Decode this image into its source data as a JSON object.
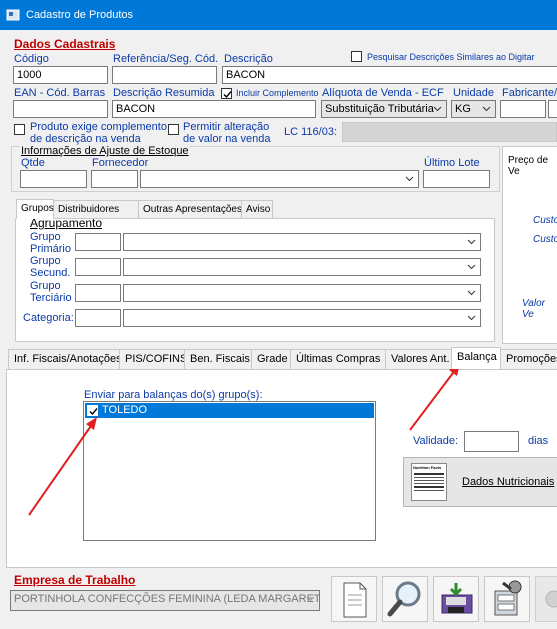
{
  "window": {
    "title": "Cadastro de Produtos"
  },
  "dados": {
    "section_title": "Dados Cadastrais",
    "codigo_label": "Código",
    "codigo_value": "1000",
    "referencia_label": "Referência/Seg. Cód.",
    "referencia_value": "",
    "descricao_label": "Descrição",
    "descricao_value": "BACON",
    "pesquisar_label": "Pesquisar Descrições Similares ao Digitar",
    "ean_label": "EAN - Cód. Barras",
    "ean_value": "",
    "desc_resumida_label": "Descrição Resumida",
    "desc_resumida_value": "BACON",
    "incluir_label": "Incluir Complemento",
    "aliquota_label": "Alíquota de Venda - ECF",
    "aliquota_value": "Substituição Tributária",
    "unidade_label": "Unidade",
    "unidade_value": "KG",
    "fabricante_label": "Fabricante/M",
    "produto_exige_label_1": "Produto exige complemento",
    "produto_exige_label_2": "de descrição na venda",
    "permitir_label_1": "Permitir alteração",
    "permitir_label_2": "de valor na venda",
    "lc_label": "LC 116/03:"
  },
  "estoque": {
    "title": "Informações de Ajuste de Estoque",
    "qtde_label": "Qtde",
    "fornecedor_label": "Fornecedor",
    "ultimo_lote_label": "Último Lote"
  },
  "right_panel": {
    "preco_label": "Preço de Ve",
    "custo1": "Custo",
    "custo2": "Custo",
    "valor_venda": "Valor Ve"
  },
  "upper_tabs": [
    "Grupos",
    "Distribuidores",
    "Outras Apresentações",
    "Aviso"
  ],
  "agrupamento": {
    "title": "Agrupamento",
    "grupo_primario": [
      "Grupo",
      "Primário"
    ],
    "grupo_secund": [
      "Grupo",
      "Secund."
    ],
    "grupo_terciario": [
      "Grupo",
      "Terciário"
    ],
    "categoria": "Categoria:"
  },
  "lower_tabs": [
    "Inf. Fiscais/Anotações",
    "PIS/COFINS",
    "Ben. Fiscais",
    "Grade",
    "Últimas Compras",
    "Valores Ant.",
    "Balança",
    "Promoções"
  ],
  "balanca": {
    "enviar_label": "Enviar para balanças do(s) grupo(s):",
    "items": [
      {
        "label": "TOLEDO",
        "checked": true
      }
    ],
    "validade_label": "Validade:",
    "validade_value": "",
    "dias_label": "dias",
    "nutri_label": "Dados Nutricionais",
    "nutri_icon_text": "Nutrition Facts"
  },
  "empresa": {
    "title": "Empresa de Trabalho",
    "value": "PORTINHOLA CONFECÇÕES FEMININA (LEDA MARGARETE"
  },
  "colors": {
    "titlebar": "#0078d7",
    "selection": "#0078d7",
    "arrow": "#e02020",
    "label_blue": "#0b3aa8",
    "section_red": "#c00000"
  },
  "toolbar_icons": [
    "new-document-icon",
    "search-magnifier-icon",
    "save-disk-icon",
    "cabinet-tools-icon",
    "disabled-action-icon"
  ]
}
